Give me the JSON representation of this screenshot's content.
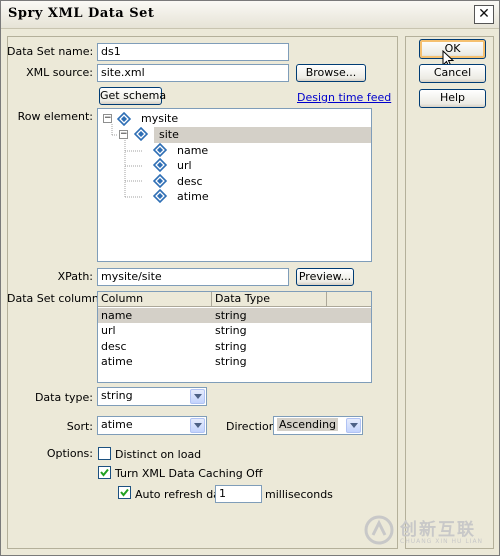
{
  "window": {
    "title": "Spry XML Data Set",
    "close_glyph": "✕"
  },
  "form": {
    "data_set_name_label": "Data Set name:",
    "data_set_name_value": "ds1",
    "xml_source_label": "XML source:",
    "xml_source_value": "site.xml",
    "browse_label": "Browse...",
    "get_schema_label": "Get schema",
    "design_time_feed_label": "Design time feed",
    "row_element_label": "Row element:",
    "tree": [
      {
        "label": "mysite",
        "expander": "−",
        "level": 0,
        "selected": false
      },
      {
        "label": "site",
        "expander": "−",
        "level": 1,
        "selected": true
      },
      {
        "label": "name",
        "level": 2,
        "selected": false
      },
      {
        "label": "url",
        "level": 2,
        "selected": false
      },
      {
        "label": "desc",
        "level": 2,
        "selected": false
      },
      {
        "label": "atime",
        "level": 2,
        "selected": false
      }
    ],
    "xpath_label": "XPath:",
    "xpath_value": "mysite/site",
    "preview_label": "Preview...",
    "columns_label": "Data Set columns:",
    "columns_header": [
      "Column",
      "Data Type"
    ],
    "columns_rows": [
      [
        "name",
        "string"
      ],
      [
        "url",
        "string"
      ],
      [
        "desc",
        "string"
      ],
      [
        "atime",
        "string"
      ]
    ],
    "data_type_label": "Data type:",
    "data_type_value": "string",
    "sort_label": "Sort:",
    "sort_value": "atime",
    "direction_label": "Direction:",
    "direction_value": "Ascending",
    "options_label": "Options:",
    "opt_distinct_label": "Distinct on load",
    "opt_distinct_checked": false,
    "opt_caching_label": "Turn XML Data Caching Off",
    "opt_caching_checked": true,
    "opt_autorefresh_label": "Auto refresh data",
    "opt_autorefresh_checked": true,
    "autorefresh_value": "1",
    "milliseconds_label": "milliseconds"
  },
  "buttons": {
    "ok_label": "OK",
    "cancel_label": "Cancel",
    "help_label": "Help"
  },
  "watermark": {
    "brand": "创新互联",
    "sub": "CHUANG XIN HU LIAN"
  },
  "colors": {
    "dialog_bg": "#ece9d8",
    "selection": "#d4d0c8",
    "link": "#0000cc",
    "field_border": "#7f9db9",
    "icon_blue": "#2f6fb5"
  }
}
